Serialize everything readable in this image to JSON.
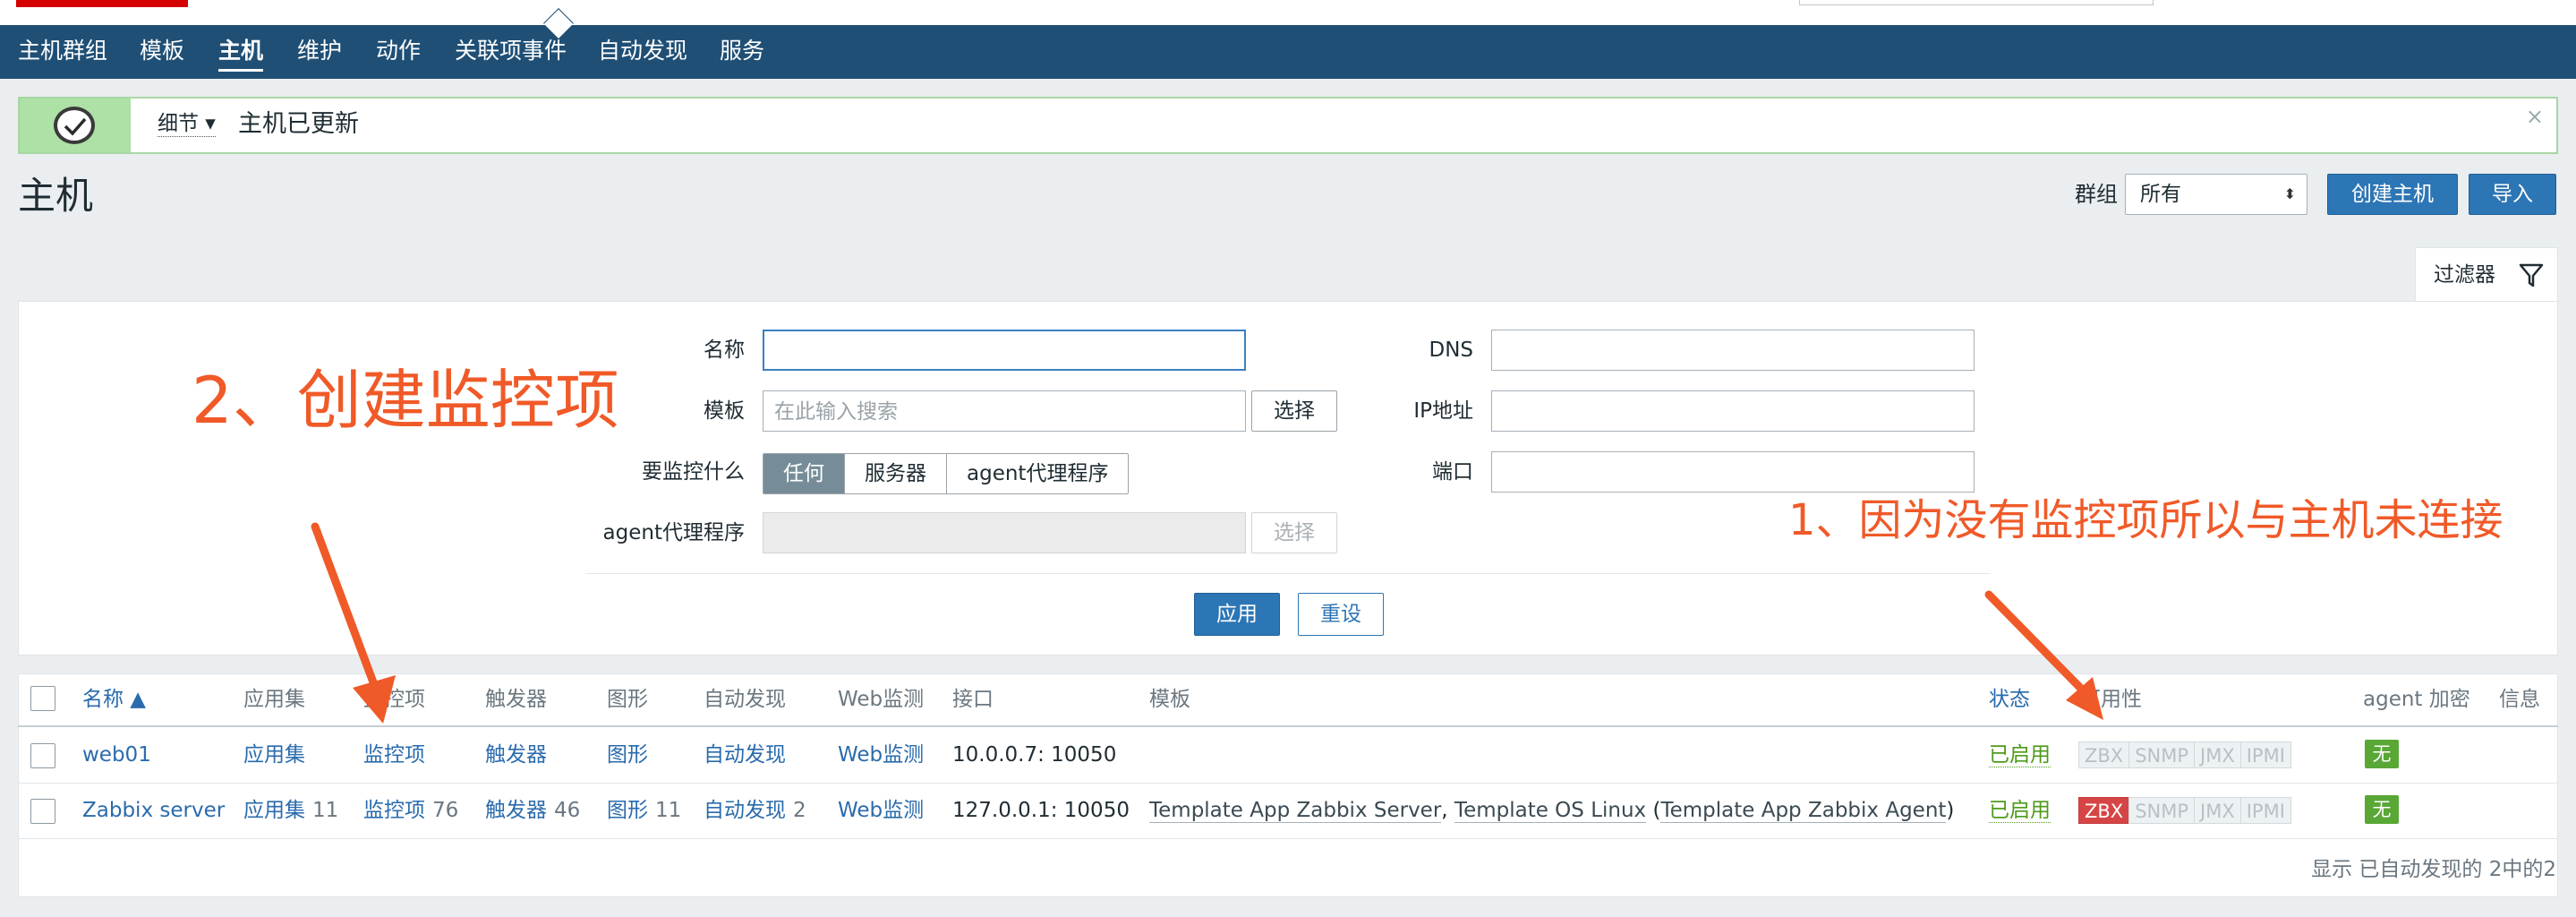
{
  "nav": {
    "items": [
      {
        "label": "主机群组"
      },
      {
        "label": "模板"
      },
      {
        "label": "主机"
      },
      {
        "label": "维护"
      },
      {
        "label": "动作"
      },
      {
        "label": "关联项事件"
      },
      {
        "label": "自动发现"
      },
      {
        "label": "服务"
      }
    ],
    "active": "主机"
  },
  "message": {
    "detail_label": "细节 ▾",
    "text": "主机已更新",
    "close": "×"
  },
  "page": {
    "title": "主机",
    "hostgroup_label": "群组",
    "hostgroup_value": "所有",
    "create_host": "创建主机",
    "import": "导入"
  },
  "filter": {
    "tab_label": "过滤器",
    "name_label": "名称",
    "name_value": "",
    "template_label": "模板",
    "template_placeholder": "在此输入搜索",
    "select_label": "选择",
    "monitored_by_label": "要监控什么",
    "monitored_by_options": [
      "任何",
      "服务器",
      "agent代理程序"
    ],
    "monitored_by_selected": "任何",
    "proxy_label": "agent代理程序",
    "proxy_select": "选择",
    "dns_label": "DNS",
    "ip_label": "IP地址",
    "port_label": "端口",
    "apply": "应用",
    "reset": "重设"
  },
  "table": {
    "headers": {
      "name": "名称 ▲",
      "applications": "应用集",
      "items": "监控项",
      "triggers": "触发器",
      "graphs": "图形",
      "discovery": "自动发现",
      "web": "Web监测",
      "interface": "接口",
      "templates": "模板",
      "status": "状态",
      "availability": "可用性",
      "encryption": "agent 加密",
      "info": "信息"
    },
    "rows": [
      {
        "name": "web01",
        "applications": "应用集",
        "applications_count": "",
        "items": "监控项",
        "items_count": "",
        "triggers": "触发器",
        "triggers_count": "",
        "graphs": "图形",
        "graphs_count": "",
        "discovery": "自动发现",
        "discovery_count": "",
        "web": "Web监测",
        "interface": "10.0.0.7: 10050",
        "tpl1": "",
        "sep1": "",
        "tpl2": "",
        "paren_open": "",
        "tpl3": "",
        "paren_close": "",
        "status": "已启用",
        "zbx": "ZBX",
        "snmp": "SNMP",
        "jmx": "JMX",
        "ipmi": "IPMI",
        "zbx_state": "unknown",
        "encryption": "无"
      },
      {
        "name": "Zabbix server",
        "applications": "应用集",
        "applications_count": "11",
        "items": "监控项",
        "items_count": "76",
        "triggers": "触发器",
        "triggers_count": "46",
        "graphs": "图形",
        "graphs_count": "11",
        "discovery": "自动发现",
        "discovery_count": "2",
        "web": "Web监测",
        "interface": "127.0.0.1: 10050",
        "tpl1": "Template App Zabbix Server",
        "sep1": ", ",
        "tpl2": "Template OS Linux",
        "paren_open": " (",
        "tpl3": "Template App Zabbix Agent",
        "paren_close": ")",
        "status": "已启用",
        "zbx": "ZBX",
        "snmp": "SNMP",
        "jmx": "JMX",
        "ipmi": "IPMI",
        "zbx_state": "unavailable",
        "encryption": "无"
      }
    ],
    "footer": "显示 已自动发现的 2中的2"
  },
  "annotations": {
    "step2": "2、创建监控项",
    "step1": "1、因为没有监控项所以与主机未连接"
  },
  "colors": {
    "nav_bg": "#1f4f75",
    "primary": "#2d76b5",
    "link": "#2a6bad",
    "enabled": "#4e9a1a",
    "zbx_unavailable": "#d64545",
    "annotation": "#f05a28",
    "success_bg": "#ade1a6"
  }
}
